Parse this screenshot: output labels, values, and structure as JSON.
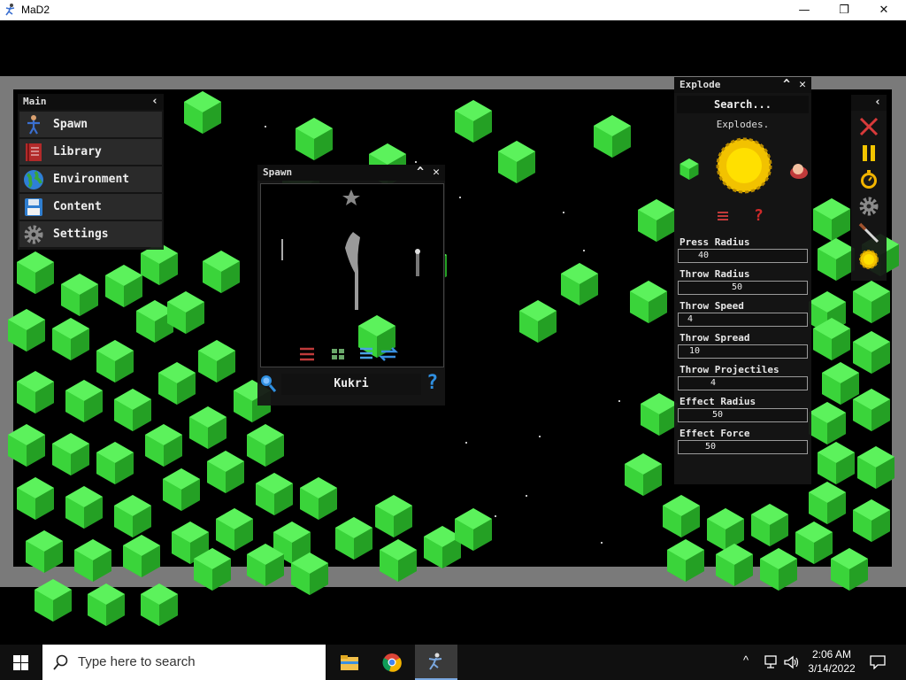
{
  "window": {
    "title": "MaD2",
    "minimize_glyph": "—",
    "restore_glyph": "❐",
    "close_glyph": "✕"
  },
  "main_panel": {
    "title": "Main",
    "collapse_glyph": "‹",
    "items": [
      {
        "label": "Spawn",
        "icon": "person-icon"
      },
      {
        "label": "Library",
        "icon": "book-icon"
      },
      {
        "label": "Environment",
        "icon": "globe-icon"
      },
      {
        "label": "Content",
        "icon": "floppy-icon"
      },
      {
        "label": "Settings",
        "icon": "gear-icon"
      }
    ]
  },
  "spawn_panel": {
    "title": "Spawn",
    "selected_item": "Kukri",
    "help_glyph": "?"
  },
  "explode_panel": {
    "title": "Explode",
    "search_label": "Search...",
    "description": "Explodes.",
    "help_glyph": "?",
    "fields": [
      {
        "label": "Press Radius",
        "value": "40"
      },
      {
        "label": "Throw Radius",
        "value": "50"
      },
      {
        "label": "Throw Speed",
        "value": "4"
      },
      {
        "label": "Throw Spread",
        "value": "10"
      },
      {
        "label": "Throw Projectiles",
        "value": "4"
      },
      {
        "label": "Effect Radius",
        "value": "50"
      },
      {
        "label": "Effect Force",
        "value": "50"
      }
    ]
  },
  "toolbar": {
    "collapse_glyph": "‹",
    "tools": [
      "close-x-icon",
      "pause-icon",
      "stopwatch-icon",
      "gear-icon",
      "knife-icon",
      "explosion-icon"
    ]
  },
  "taskbar": {
    "search_placeholder": "Type here to search",
    "time": "2:06 AM",
    "date": "3/14/2022"
  },
  "colors": {
    "cube": "#3ad43a",
    "frame": "#7a7a7a",
    "panel": "#161616",
    "accent_blue": "#2f8fe0"
  }
}
